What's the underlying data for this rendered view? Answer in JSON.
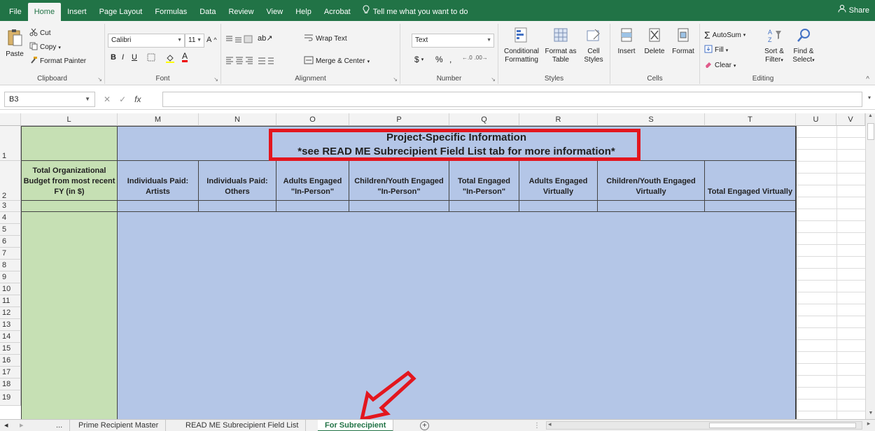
{
  "menu": {
    "tabs": [
      "File",
      "Home",
      "Insert",
      "Page Layout",
      "Formulas",
      "Data",
      "Review",
      "View",
      "Help",
      "Acrobat"
    ],
    "tell_me": "Tell me what you want to do",
    "share": "Share"
  },
  "ribbon": {
    "clipboard": {
      "paste": "Paste",
      "cut": "Cut",
      "copy": "Copy",
      "format_painter": "Format Painter",
      "label": "Clipboard"
    },
    "font": {
      "name": "Calibri",
      "size": "11",
      "label": "Font"
    },
    "alignment": {
      "wrap_text": "Wrap Text",
      "merge_center": "Merge & Center",
      "label": "Alignment"
    },
    "number": {
      "format": "Text",
      "currency": "$",
      "percent": "%",
      "comma": ",",
      "label": "Number"
    },
    "styles": {
      "conditional": "Conditional",
      "conditional2": "Formatting",
      "format_as": "Format as",
      "format_as2": "Table",
      "cell": "Cell",
      "cell2": "Styles",
      "label": "Styles"
    },
    "cells": {
      "insert": "Insert",
      "delete": "Delete",
      "format": "Format",
      "label": "Cells"
    },
    "editing": {
      "autosum": "AutoSum",
      "fill": "Fill",
      "clear": "Clear",
      "sort": "Sort &",
      "sort2": "Filter",
      "find": "Find &",
      "find2": "Select",
      "label": "Editing"
    }
  },
  "formula_bar": {
    "name_box": "B3",
    "fx": "fx",
    "value": ""
  },
  "grid": {
    "columns": [
      "L",
      "M",
      "N",
      "O",
      "P",
      "Q",
      "R",
      "S",
      "T",
      "U",
      "V"
    ],
    "rows": [
      "1",
      "2",
      "3",
      "4",
      "5",
      "6",
      "7",
      "8",
      "9",
      "10",
      "11",
      "12",
      "13",
      "14",
      "15",
      "16",
      "17",
      "18",
      "19"
    ],
    "banner_line1": "Project-Specific Information",
    "banner_line2": "*see READ ME Subrecipient Field List tab for more information*",
    "headers": {
      "L": "Total Organizational Budget from most recent FY (in $)",
      "M": "Individuals Paid: Artists",
      "N": "Individuals Paid: Others",
      "O": "Adults Engaged \"In-Person\"",
      "P": "Children/Youth Engaged \"In-Person\"",
      "Q": "Total Engaged \"In-Person\"",
      "R": "Adults Engaged Virtually",
      "S": "Children/Youth Engaged Virtually",
      "T": "Total Engaged Virtually"
    }
  },
  "sheet_tabs": {
    "more": "...",
    "tabs": [
      "Prime Recipient Master",
      "READ ME Subrecipient Field List",
      "For Subrecipient"
    ],
    "active": "For Subrecipient",
    "add": "+"
  },
  "colors": {
    "excel_green": "#217346",
    "col_l_fill": "#c6e0b4",
    "project_fill": "#b4c6e7",
    "highlight_red": "#e3161e"
  }
}
